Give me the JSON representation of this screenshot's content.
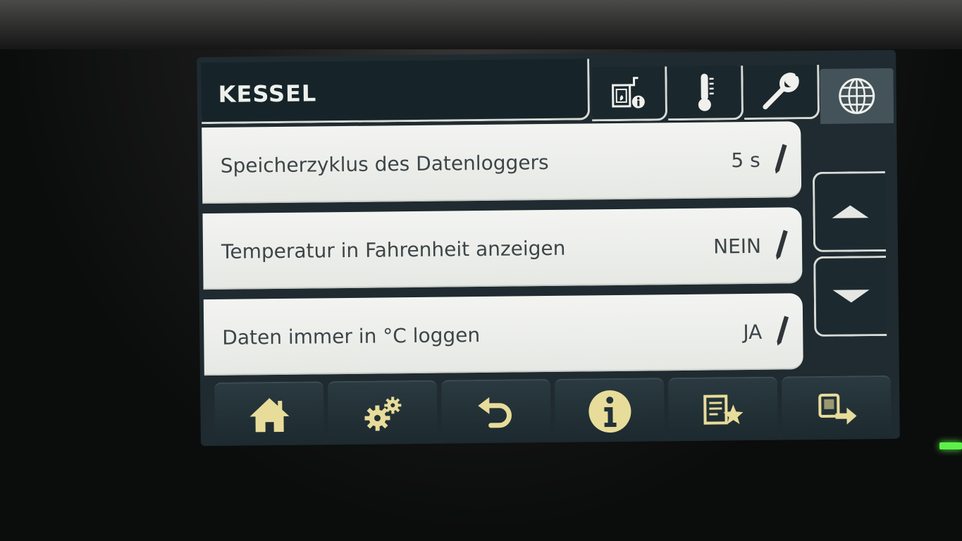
{
  "header": {
    "title": "KESSEL"
  },
  "tabs": [
    {
      "icon": "boiler-info-icon"
    },
    {
      "icon": "thermometer-icon"
    },
    {
      "icon": "wrench-icon"
    },
    {
      "icon": "globe-icon",
      "active": true
    }
  ],
  "rows": [
    {
      "label": "Speicherzyklus des Datenloggers",
      "value": "5 s"
    },
    {
      "label": "Temperatur in Fahrenheit anzeigen",
      "value": "NEIN"
    },
    {
      "label": "Daten immer in °C loggen",
      "value": "JA"
    }
  ],
  "scroll": {
    "up_icon": "arrow-up-icon",
    "down_icon": "arrow-down-icon"
  },
  "footer": [
    {
      "icon": "home-icon"
    },
    {
      "icon": "gears-icon"
    },
    {
      "icon": "back-icon"
    },
    {
      "icon": "info-icon"
    },
    {
      "icon": "favorites-icon"
    },
    {
      "icon": "transfer-icon"
    }
  ],
  "colors": {
    "accent": "#e8dc9a",
    "screen_bg": "#1f2b30",
    "row_bg": "#f0f1ee",
    "text": "#3d4548",
    "led": "#5df04a"
  }
}
